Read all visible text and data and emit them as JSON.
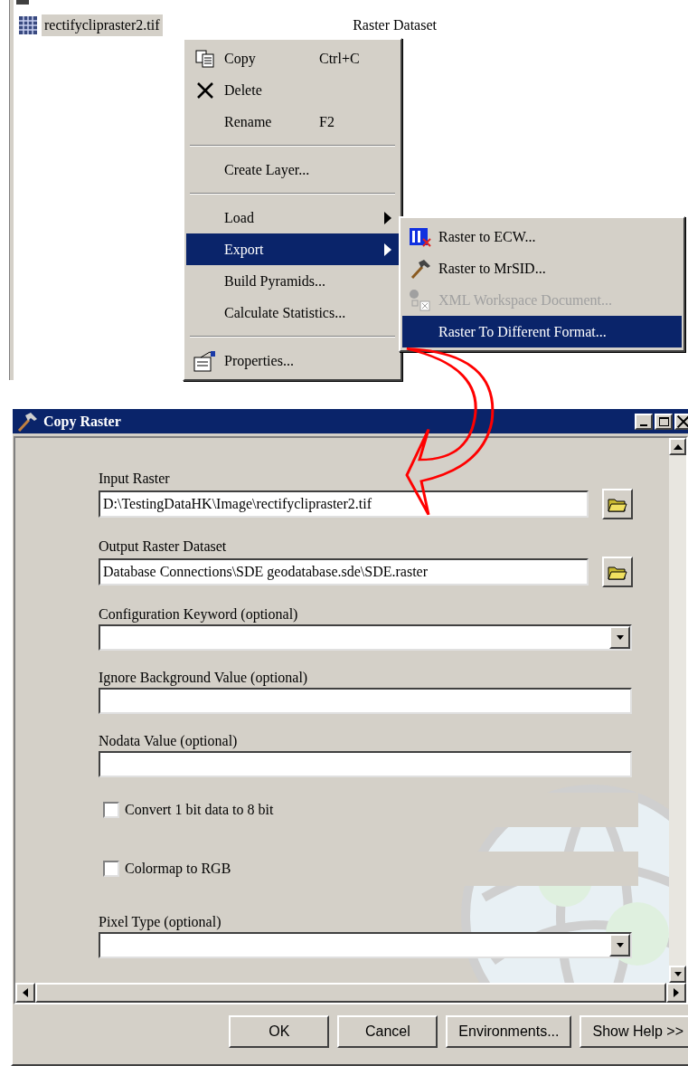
{
  "file_row": {
    "name": "rectifyclipraster2.tif",
    "type": "Raster Dataset",
    "selected": true
  },
  "context_menu": {
    "items": [
      {
        "kind": "item",
        "label": "Copy",
        "shortcut": "Ctrl+C",
        "selected": false,
        "has_submenu": false
      },
      {
        "kind": "item",
        "label": "Delete",
        "selected": false,
        "has_submenu": false
      },
      {
        "kind": "item",
        "label": "Rename",
        "shortcut": "F2",
        "selected": false,
        "has_submenu": false
      },
      {
        "kind": "separator"
      },
      {
        "kind": "item",
        "label": "Create Layer...",
        "selected": false,
        "has_submenu": false
      },
      {
        "kind": "separator"
      },
      {
        "kind": "item",
        "label": "Load",
        "selected": false,
        "has_submenu": true
      },
      {
        "kind": "item",
        "label": "Export",
        "selected": true,
        "has_submenu": true
      },
      {
        "kind": "item",
        "label": "Build Pyramids...",
        "selected": false,
        "has_submenu": false
      },
      {
        "kind": "item",
        "label": "Calculate Statistics...",
        "selected": false,
        "has_submenu": false
      },
      {
        "kind": "separator"
      },
      {
        "kind": "item",
        "label": "Properties...",
        "selected": false,
        "has_submenu": false
      }
    ]
  },
  "submenu": {
    "items": [
      {
        "label": "Raster to ECW...",
        "selected": false,
        "disabled": false
      },
      {
        "label": "Raster to MrSID...",
        "selected": false,
        "disabled": false
      },
      {
        "label": "XML Workspace Document...",
        "selected": false,
        "disabled": true
      },
      {
        "label": "Raster To Different Format...",
        "selected": true,
        "disabled": false
      }
    ]
  },
  "dialog": {
    "title": "Copy Raster",
    "fields": [
      {
        "kind": "path",
        "label": "Input Raster",
        "value": "D:\\TestingDataHK\\Image\\rectifyclipraster2.tif"
      },
      {
        "kind": "path",
        "label": "Output Raster Dataset",
        "value": "Database Connections\\SDE geodatabase.sde\\SDE.raster"
      },
      {
        "kind": "combo",
        "label": "Configuration Keyword (optional)"
      },
      {
        "kind": "text",
        "label": "Ignore Background Value (optional)"
      },
      {
        "kind": "text",
        "label": "Nodata Value (optional)"
      },
      {
        "kind": "checkbox",
        "label": "Convert 1 bit data to 8 bit",
        "checked": false
      },
      {
        "kind": "checkbox",
        "label": "Colormap to RGB",
        "checked": false
      },
      {
        "kind": "combo",
        "label": "Pixel Type (optional)"
      }
    ],
    "buttons": [
      "OK",
      "Cancel",
      "Environments...",
      "Show Help >>"
    ]
  }
}
